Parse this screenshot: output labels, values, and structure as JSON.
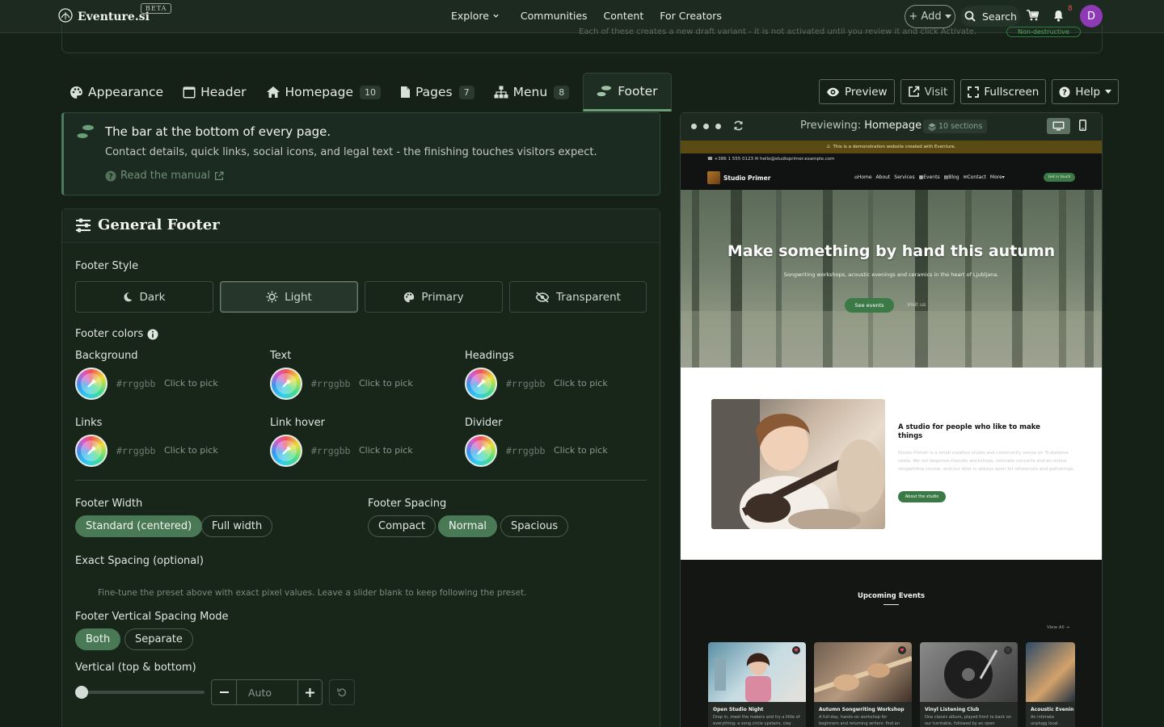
{
  "app": {
    "name": "Eventure.si",
    "beta": "BETA",
    "nav": [
      "Explore",
      "Communities",
      "Content",
      "For Creators"
    ],
    "add_label": "+ Add",
    "search_label": "Search",
    "notifications_count": "8",
    "avatar_initial": "D"
  },
  "remnant": {
    "text": "Each of these creates a new draft variant - it is not activated until you review it and click Activate.",
    "pill": "Non-destructive"
  },
  "tabs": [
    {
      "label": "Appearance",
      "count": ""
    },
    {
      "label": "Header",
      "count": ""
    },
    {
      "label": "Homepage",
      "count": "10"
    },
    {
      "label": "Pages",
      "count": "7"
    },
    {
      "label": "Menu",
      "count": "8"
    },
    {
      "label": "Footer",
      "count": "",
      "active": true
    }
  ],
  "actions": {
    "preview": "Preview",
    "visit": "Visit",
    "fullscreen": "Fullscreen",
    "help": "Help"
  },
  "info": {
    "title": "The bar at the bottom of every page.",
    "description": "Contact details, quick links, social icons, and legal text - the finishing touches visitors expect.",
    "manual_link": "Read the manual"
  },
  "general_footer": {
    "title": "General Footer",
    "style_label": "Footer Style",
    "styles": [
      "Dark",
      "Light",
      "Primary",
      "Transparent"
    ],
    "selected_style": "Light",
    "colors_label": "Footer colors",
    "colors": [
      {
        "label": "Background",
        "hex": "#rrggbb",
        "action": "Click to pick"
      },
      {
        "label": "Text",
        "hex": "#rrggbb",
        "action": "Click to pick"
      },
      {
        "label": "Headings",
        "hex": "#rrggbb",
        "action": "Click to pick"
      },
      {
        "label": "Links",
        "hex": "#rrggbb",
        "action": "Click to pick"
      },
      {
        "label": "Link hover",
        "hex": "#rrggbb",
        "action": "Click to pick"
      },
      {
        "label": "Divider",
        "hex": "#rrggbb",
        "action": "Click to pick"
      }
    ],
    "width_label": "Footer Width",
    "widths": [
      "Standard (centered)",
      "Full width"
    ],
    "selected_width": "Standard (centered)",
    "spacing_label": "Footer Spacing",
    "spacings": [
      "Compact",
      "Normal",
      "Spacious"
    ],
    "selected_spacing": "Normal",
    "exact_spacing_label": "Exact Spacing (optional)",
    "exact_spacing_hint": "Fine-tune the preset above with exact pixel values. Leave a slider blank to keep following the preset.",
    "vmode_label": "Footer Vertical Spacing Mode",
    "vmodes": [
      "Both",
      "Separate"
    ],
    "selected_vmode": "Both",
    "vertical_label": "Vertical (top & bottom)",
    "vertical_value": "Auto"
  },
  "preview": {
    "label": "Previewing:",
    "page": "Homepage",
    "sections": "10 sections",
    "site": {
      "demo_banner": "This is a demonstration website created with Eventure.",
      "phone": "+386 1 555 0123",
      "email": "hello@studioprimer.example.com",
      "name": "Studio Primer",
      "nav": [
        "Home",
        "About",
        "Services",
        "Events",
        "Blog",
        "Contact",
        "More"
      ],
      "cta": "Get in touch",
      "hero_title": "Make something by hand this autumn",
      "hero_sub": "Songwriting workshops, acoustic evenings and ceramics in the heart of Ljubljana.",
      "hero_btn": "See events",
      "hero_btn2": "Visit us",
      "about_title": "A studio for people who like to make things",
      "about_text": "Studio Primer is a small creative studio and community venue on Trubarjeva cesta. We run beginner-friendly workshops, intimate concerts and an online songwriting course, and our door is always open for rehearsals and gatherings.",
      "about_btn": "About the studio",
      "events_title": "Upcoming Events",
      "view_all": "View All",
      "events": [
        {
          "title": "Open Studio Night",
          "desc": "Drop in, meet the makers and try a little of everything: a song circle upstairs, clay"
        },
        {
          "title": "Autumn Songwriting Workshop",
          "desc": "A full-day, hands-on workshop for beginners and returning writers: find an"
        },
        {
          "title": "Vinyl Listening Club",
          "desc": "One classic album, played front to back on our turntable, followed by an open"
        },
        {
          "title": "Acoustic Evenin",
          "desc": "An intimate unplugg local songwriters in t"
        }
      ]
    }
  },
  "colors": {
    "accent": "#4a7a55",
    "bg": "#152117",
    "site_green": "#3b7a47"
  }
}
